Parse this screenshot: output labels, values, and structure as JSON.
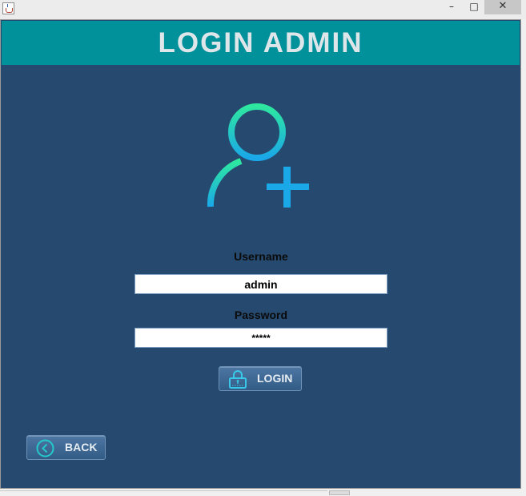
{
  "window": {
    "controls": {
      "minimize": "–",
      "maximize": "□",
      "close": "✕"
    }
  },
  "header": {
    "title": "LOGIN ADMIN"
  },
  "form": {
    "username_label": "Username",
    "username_value": "admin",
    "password_label": "Password",
    "password_value": "*****",
    "login_button_label": "LOGIN"
  },
  "back_button_label": "BACK",
  "colors": {
    "header_bg": "#00919b",
    "panel_bg": "#264a6f",
    "title_text": "#dfe6ea",
    "icon_gradient_top": "#2ee8a0",
    "icon_gradient_bottom": "#1aa8e8"
  },
  "icons": {
    "app": "java-cup-icon",
    "hero": "user-add-icon",
    "login": "padlock-icon",
    "back": "chevron-left-circle-icon"
  }
}
